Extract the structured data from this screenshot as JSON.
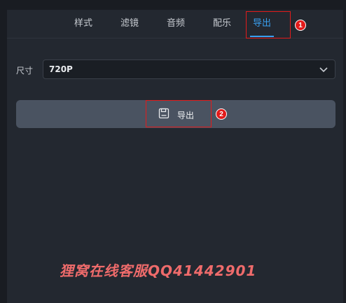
{
  "tabs": [
    {
      "label": "样式"
    },
    {
      "label": "滤镜"
    },
    {
      "label": "音频"
    },
    {
      "label": "配乐"
    },
    {
      "label": "导出"
    }
  ],
  "active_tab": "导出",
  "annotations": {
    "step1": "1",
    "step2": "2"
  },
  "size": {
    "label": "尺寸",
    "value": "720P"
  },
  "export_button": {
    "label": "导出"
  },
  "watermark": "狸窝在线客服QQ41442901",
  "colors": {
    "accent": "#3aa0f0",
    "annotation": "#e21b1b",
    "button_bg": "#4a5361",
    "panel_bg": "#232830"
  }
}
